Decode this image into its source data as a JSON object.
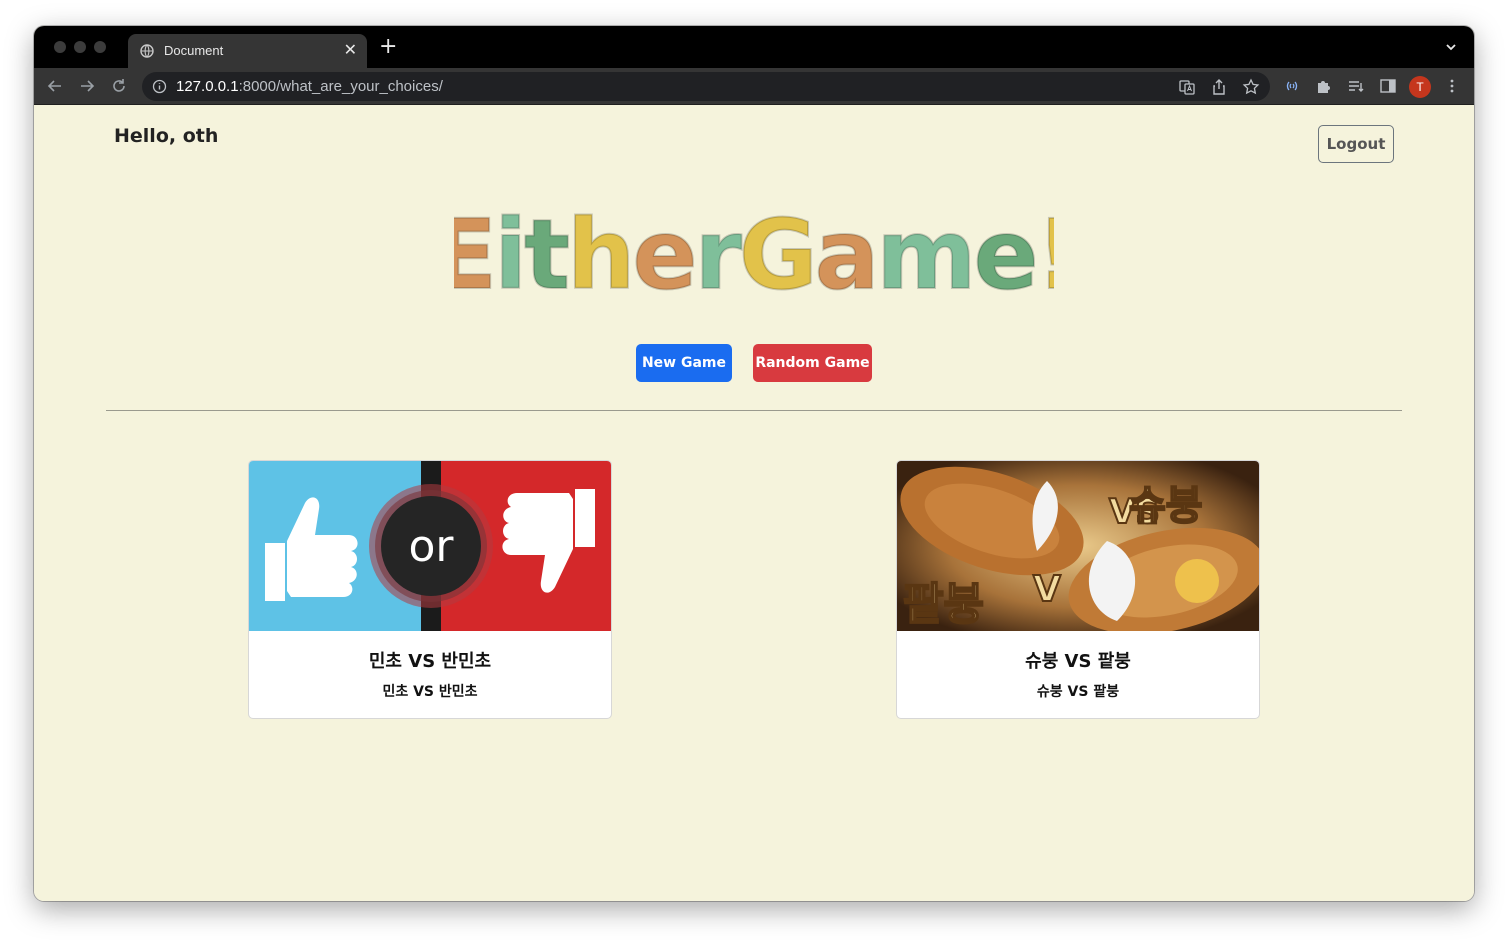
{
  "browser": {
    "tab_title": "Document",
    "tab_close": "✕",
    "new_tab": "+",
    "url_host": "127.0.0.1",
    "url_path": ":8000/what_are_your_choices/",
    "profile_initial": "T"
  },
  "header": {
    "greeting": "Hello, oth",
    "logout_label": "Logout"
  },
  "logo": {
    "text": "EitherGame!",
    "letters": [
      {
        "ch": "E",
        "color": "#d4935a"
      },
      {
        "ch": "i",
        "color": "#7fbf9a"
      },
      {
        "ch": "t",
        "color": "#6aa97a"
      },
      {
        "ch": "h",
        "color": "#e2c24a"
      },
      {
        "ch": "e",
        "color": "#d4935a"
      },
      {
        "ch": "r",
        "color": "#7fbf9a"
      },
      {
        "ch": "G",
        "color": "#e2c24a"
      },
      {
        "ch": "a",
        "color": "#d4935a"
      },
      {
        "ch": "m",
        "color": "#7fbf9a"
      },
      {
        "ch": "e",
        "color": "#6aa97a"
      },
      {
        "ch": "!",
        "color": "#e2c24a"
      }
    ]
  },
  "actions": {
    "new_game_label": "New Game",
    "random_game_label": "Random Game"
  },
  "cards": [
    {
      "title": "민초 VS 반민초",
      "subtitle": "민초 VS 반민초",
      "image": "thumbs-up-or-thumbs-down"
    },
    {
      "title": "슈붕 VS 팥붕",
      "subtitle": "슈붕 VS 팥붕",
      "image": "bungeoppang-cream-vs-redbean",
      "image_text_left": "팥붕",
      "image_text_right": "슈붕",
      "image_vs": "VS"
    }
  ],
  "colors": {
    "page_bg": "#f5f3dc",
    "primary": "#1a6cf0",
    "danger": "#d83a3f"
  }
}
